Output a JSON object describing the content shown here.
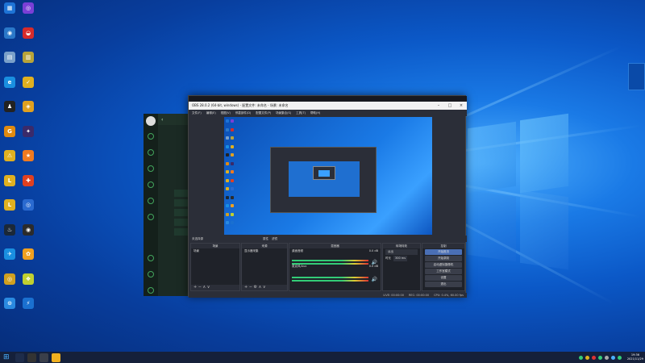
{
  "desktop": {
    "icons": [
      {
        "label": "",
        "color": "#1e73d6",
        "glyph": "▦"
      },
      {
        "label": "",
        "color": "#7a3fd6",
        "glyph": "◎"
      },
      {
        "label": "",
        "color": "#2b78c9",
        "glyph": "◉"
      },
      {
        "label": "",
        "color": "#d62b2b",
        "glyph": "◒"
      },
      {
        "label": "",
        "color": "#7aa0c9",
        "glyph": "▤"
      },
      {
        "label": "",
        "color": "#b8a43a",
        "glyph": "▥"
      },
      {
        "label": "",
        "color": "#1a8fe0",
        "glyph": "e"
      },
      {
        "label": "",
        "color": "#e0b020",
        "glyph": "✓"
      },
      {
        "label": "",
        "color": "#222222",
        "glyph": "♟"
      },
      {
        "label": "",
        "color": "#e0a020",
        "glyph": "◈"
      },
      {
        "label": "",
        "color": "#e08a10",
        "glyph": "G"
      },
      {
        "label": "",
        "color": "#3a2a6a",
        "glyph": "✦"
      },
      {
        "label": "",
        "color": "#e0b020",
        "glyph": "⚠"
      },
      {
        "label": "",
        "color": "#f07a20",
        "glyph": "★"
      },
      {
        "label": "",
        "color": "#e0b020",
        "glyph": "L"
      },
      {
        "label": "",
        "color": "#e04020",
        "glyph": "✚"
      },
      {
        "label": "",
        "color": "#e0b020",
        "glyph": "L"
      },
      {
        "label": "",
        "color": "#2a6ad0",
        "glyph": "◎"
      },
      {
        "label": "",
        "color": "#1b2838",
        "glyph": "♨"
      },
      {
        "label": "",
        "color": "#2b2b2b",
        "glyph": "◉"
      },
      {
        "label": "",
        "color": "#1a8fe0",
        "glyph": "✈"
      },
      {
        "label": "",
        "color": "#f0a020",
        "glyph": "✿"
      },
      {
        "label": "",
        "color": "#d0a020",
        "glyph": "◎"
      },
      {
        "label": "",
        "color": "#c0d030",
        "glyph": "❖"
      },
      {
        "label": "",
        "color": "#2a8ae0",
        "glyph": "⊙"
      },
      {
        "label": "",
        "color": "#1a70d0",
        "glyph": "⚡"
      }
    ]
  },
  "obs": {
    "title": "OBS 28.0.2 (64-bit, windows) - 配置文件: 未命名 - 场景: 未命名",
    "menu": [
      "文件(F)",
      "编辑(E)",
      "视图(V)",
      "停靠部件(D)",
      "配置文件(P)",
      "场景集合(S)",
      "工具(T)",
      "帮助(H)"
    ],
    "toolbar_label": "未选择源",
    "toolbar_props": "属性",
    "toolbar_filters": "滤镜",
    "docks": {
      "scenes": {
        "title": "场景",
        "items": [
          "场景"
        ]
      },
      "sources": {
        "title": "来源",
        "items": [
          "显示器采集"
        ]
      },
      "mixer": {
        "title": "混音器",
        "tracks": [
          "桌面音频",
          "麦克风/Aux"
        ],
        "db": [
          "0.0 dB",
          "0.0 dB"
        ]
      },
      "transitions": {
        "title": "转场特效",
        "type": "淡出",
        "duration_label": "时长",
        "duration": "300 ms"
      },
      "controls": {
        "title": "控制",
        "buttons": [
          "开始推流",
          "开始录制",
          "启动虚拟摄像机",
          "工作室模式",
          "设置",
          "退出"
        ]
      }
    },
    "status": [
      "LIVE: 00:00:00",
      "REC: 00:00:00",
      "CPU: 0.4%, 60.00 fps"
    ]
  },
  "taskbar": {
    "time": "19:36",
    "date": "2021/11/29"
  }
}
